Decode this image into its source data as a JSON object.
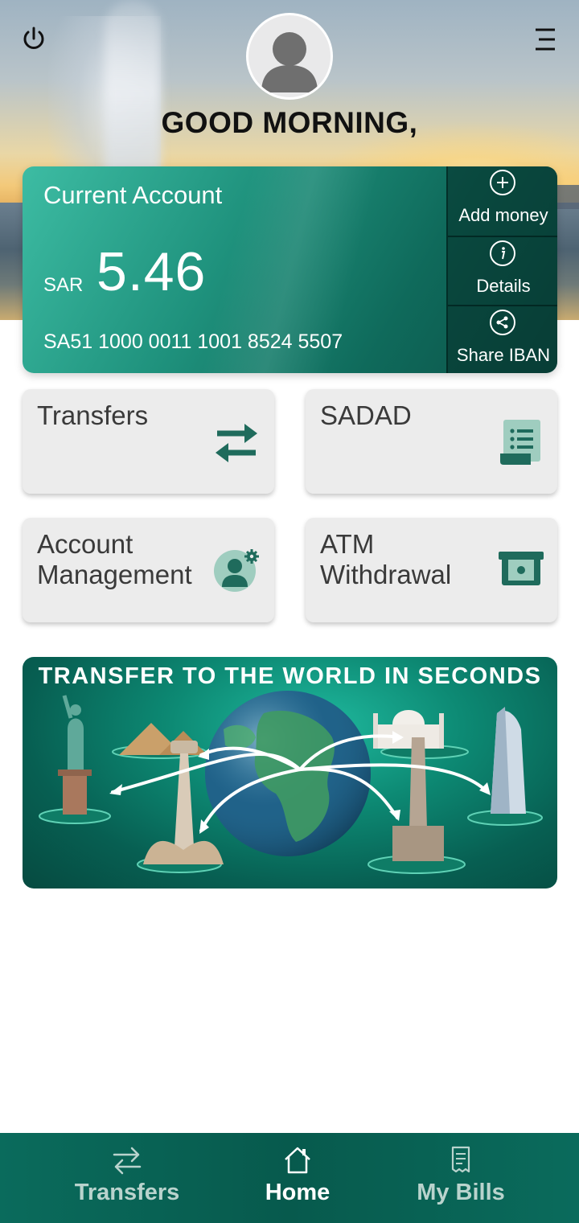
{
  "header": {
    "greeting": "GOOD MORNING,",
    "icons": {
      "power": "power-icon",
      "menu": "menu-icon",
      "avatar": "user-avatar-icon"
    }
  },
  "account": {
    "title": "Current Account",
    "currency": "SAR",
    "balance": "5.46",
    "iban": "SA51 1000 0011 1001 8524 5507",
    "actions": [
      {
        "label": "Add money",
        "icon": "plus-icon"
      },
      {
        "label": "Details",
        "icon": "info-icon"
      },
      {
        "label": "Share IBAN",
        "icon": "share-icon"
      }
    ]
  },
  "tiles": [
    {
      "label": "Transfers",
      "icon": "transfer-arrows-icon"
    },
    {
      "label": "SADAD",
      "icon": "bill-receipt-icon"
    },
    {
      "label_line1": "Account",
      "label_line2": "Management",
      "icon": "user-settings-icon"
    },
    {
      "label_line1": "ATM",
      "label_line2": "Withdrawal",
      "icon": "atm-cash-icon"
    }
  ],
  "promo": {
    "title": "TRANSFER TO THE WORLD IN SECONDS"
  },
  "bottom_nav": {
    "items": [
      {
        "label": "Transfers",
        "icon": "transfer-arrows-icon",
        "active": false
      },
      {
        "label": "Home",
        "icon": "home-icon",
        "active": true
      },
      {
        "label": "My Bills",
        "icon": "bill-icon",
        "active": false
      }
    ]
  },
  "colors": {
    "brand_green": "#0a6b5c",
    "icon_green": "#1f6b5c",
    "tile_bg": "#ececec",
    "nav_inactive": "#b9d3cd",
    "nav_active": "#ffffff"
  }
}
